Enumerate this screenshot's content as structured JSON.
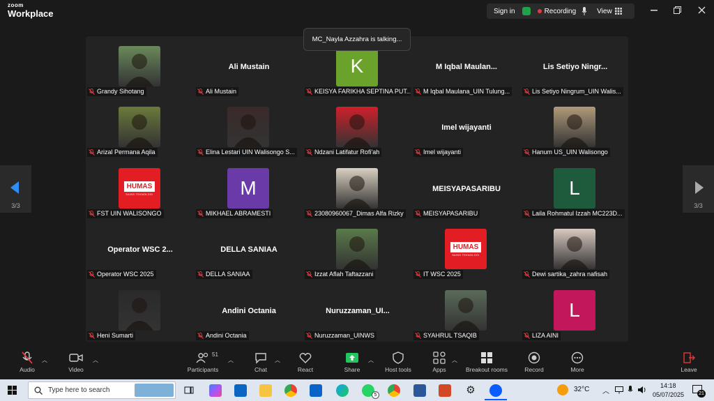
{
  "titlebar": {
    "logo_top": "zoom",
    "logo_bottom": "Workplace",
    "sign_in": "Sign in",
    "recording": "Recording",
    "view": "View"
  },
  "toast": "MC_Nayla Azzahra is talking...",
  "nav": {
    "left_page": "3/3",
    "right_page": "3/3"
  },
  "participants": [
    {
      "name": "Grandy Sihotang",
      "display": "",
      "kind": "photo",
      "bg": "#6a8a5a"
    },
    {
      "name": "Ali Mustain",
      "display": "Ali Mustain",
      "kind": "name"
    },
    {
      "name": "KEISYA FARIKHA SEPTINA PUT...",
      "display": "K",
      "kind": "initial",
      "bg": "#6aa22c"
    },
    {
      "name": "M Iqbal Maulana_UIN Tulung...",
      "display": "M  Iqbal  Maulan...",
      "kind": "name"
    },
    {
      "name": "Lis Setiyo Ningrum_UIN Walis...",
      "display": "Lis  Setiyo  Ningr...",
      "kind": "name"
    },
    {
      "name": "Arizal Permana Aqila",
      "display": "",
      "kind": "photo",
      "bg": "#6b7a3a"
    },
    {
      "name": "Elina Lestari UIN Walisongo S...",
      "display": "",
      "kind": "photo",
      "bg": "#3a2a2a"
    },
    {
      "name": "Ndzani Latifatur Rofi'ah",
      "display": "",
      "kind": "photo",
      "bg": "#d01f2a"
    },
    {
      "name": "Imel wijayanti",
      "display": "Imel wijayanti",
      "kind": "name"
    },
    {
      "name": "Hanum US_UIN Walisongo",
      "display": "",
      "kind": "photo",
      "bg": "#b09a7a"
    },
    {
      "name": "FST UIN WALISONGO",
      "display": "",
      "kind": "humas"
    },
    {
      "name": "MIKHAEL ABRAMESTI",
      "display": "M",
      "kind": "initial",
      "bg": "#6a3aa8"
    },
    {
      "name": "23080960067_Dimas Alfa Rizky",
      "display": "",
      "kind": "photo",
      "bg": "#d8d0c0"
    },
    {
      "name": "MEISYAPASARIBU",
      "display": "MEISYAPASARIBU",
      "kind": "name"
    },
    {
      "name": "Laila Rohmatul Izzah MC223D...",
      "display": "L",
      "kind": "initial",
      "bg": "#1e5a3c"
    },
    {
      "name": "Operator WSC 2025",
      "display": "Operator  WSC  2...",
      "kind": "name"
    },
    {
      "name": "DELLA SANIAA",
      "display": "DELLA SANIAA",
      "kind": "name"
    },
    {
      "name": "Izzat Aflah Taftazzani",
      "display": "",
      "kind": "photo",
      "bg": "#5a7a4a"
    },
    {
      "name": "IT WSC 2025",
      "display": "",
      "kind": "humas"
    },
    {
      "name": "Dewi sartika_zahra nafisah",
      "display": "",
      "kind": "photo",
      "bg": "#d8c8c0"
    },
    {
      "name": "Heni Sumarti",
      "display": "",
      "kind": "photo",
      "bg": "#2a2a2a"
    },
    {
      "name": "Andini Octania",
      "display": "Andini Octania",
      "kind": "name"
    },
    {
      "name": "Nuruzzaman_UINWS",
      "display": "Nuruzzaman_UI...",
      "kind": "name"
    },
    {
      "name": "SYAHRUL TSAQIB",
      "display": "",
      "kind": "photo",
      "bg": "#5a6a5a"
    },
    {
      "name": "LIZA AINI",
      "display": "L",
      "kind": "initial",
      "bg": "#c2185b"
    }
  ],
  "humas": {
    "brand": "HUMAS",
    "sub": "SAINS TEKNOLOGI"
  },
  "toolbar": {
    "audio": "Audio",
    "video": "Video",
    "participants": "Participants",
    "participant_count": "51",
    "chat": "Chat",
    "react": "React",
    "share": "Share",
    "host_tools": "Host tools",
    "apps": "Apps",
    "breakout_rooms": "Breakout rooms",
    "record": "Record",
    "more": "More",
    "leave": "Leave"
  },
  "taskbar": {
    "search_placeholder": "Type here to search",
    "whatsapp_badge": "5",
    "weather": "32°C",
    "time": "14:18",
    "date": "05/07/2025",
    "notifications": "21"
  },
  "colors": {
    "accent_green": "#1fa34a",
    "record_red": "#e5383b",
    "share_green": "#22c55e",
    "leave_red": "#e5383b"
  }
}
